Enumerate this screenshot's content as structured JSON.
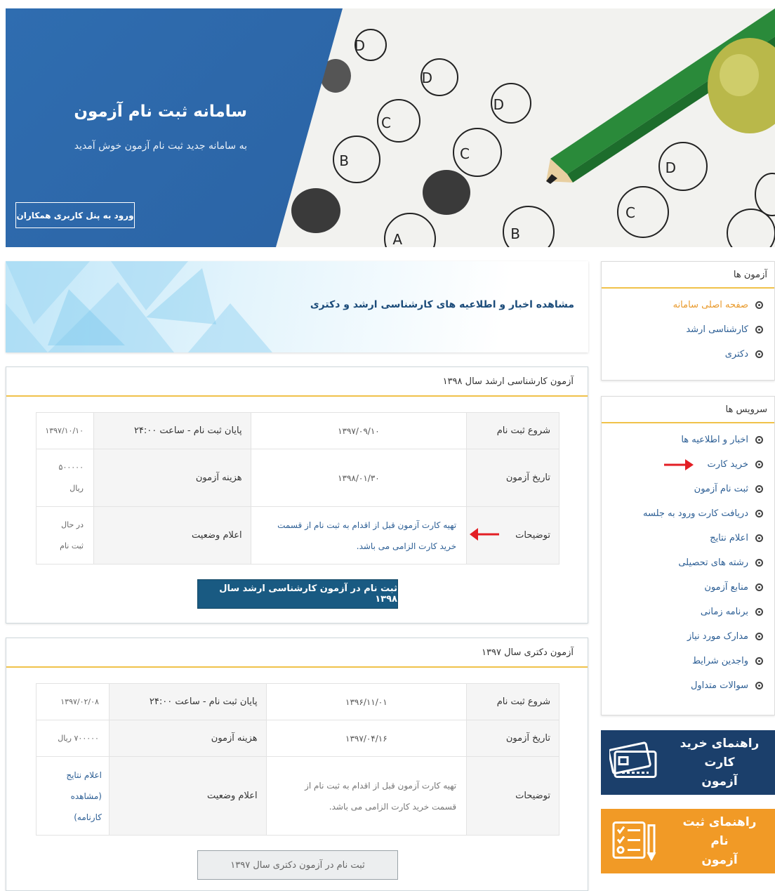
{
  "header": {
    "title": "سامانه ثبت نام آزمون",
    "subtitle": "به سامانه جدید ثبت نام آزمون خوش آمدید",
    "login_button": "ورود به پنل کاربری همکاران",
    "accent_color": "#2f6db0"
  },
  "sidebar": {
    "exams_box": {
      "title": "آزمون ها",
      "items": [
        {
          "label": "صفحه اصلی سامانه",
          "active": true
        },
        {
          "label": "کارشناسی ارشد",
          "active": false
        },
        {
          "label": "دکتری",
          "active": false
        }
      ]
    },
    "services_box": {
      "title": "سرویس ها",
      "items": [
        {
          "label": "اخبار و اطلاعیه ها"
        },
        {
          "label": "خرید کارت"
        },
        {
          "label": "ثبت نام آزمون"
        },
        {
          "label": "دریافت کارت ورود به جلسه"
        },
        {
          "label": "اعلام نتایج"
        },
        {
          "label": "رشته های تحصیلی"
        },
        {
          "label": "منابع آزمون"
        },
        {
          "label": "برنامه زمانی"
        },
        {
          "label": "مدارک مورد نیاز"
        },
        {
          "label": "واجدین شرایط"
        },
        {
          "label": "سوالات متداول"
        }
      ]
    },
    "guide_card": {
      "line1": "راهنمای خرید کارت",
      "line2": "آزمون",
      "color": "#1b3f6b",
      "icon": "credit-card-icon"
    },
    "guide_register": {
      "line1": "راهنمای ثبت نام",
      "line2": "آزمون",
      "color": "#f19a26",
      "icon": "checklist-icon"
    }
  },
  "news_banner": {
    "title": "مشاهده اخبار و اطلاعیه های کارشناسی ارشد و دکتری"
  },
  "exams": [
    {
      "title": "آزمون کارشناسی ارشد سال ۱۳۹۸",
      "rows": {
        "reg_start_label": "شروع ثبت نام",
        "reg_start_value": "۱۳۹۷/۰۹/۱۰",
        "reg_end_label": "پایان ثبت نام - ساعت ۲۴:۰۰",
        "reg_end_value": "۱۳۹۷/۱۰/۱۰",
        "exam_date_label": "تاریخ آزمون",
        "exam_date_value": "۱۳۹۸/۰۱/۳۰",
        "fee_label": "هزینه آزمون",
        "fee_amount": "۵۰۰۰۰۰",
        "fee_unit": "ریال",
        "notes_label": "توضیحات",
        "notes_line1": "تهیه کارت آزمون قبل از اقدام به ثبت نام از قسمت",
        "notes_line2": "خرید کارت الزامی می باشد.",
        "status_label": "اعلام وضعیت",
        "status_line1": "در حال",
        "status_line2": "ثبت نام"
      },
      "button": "ثبت نام در آزمون کارشناسی ارشد سال ۱۳۹۸",
      "button_enabled": true
    },
    {
      "title": "آزمون دکتری سال ۱۳۹۷",
      "rows": {
        "reg_start_label": "شروع ثبت نام",
        "reg_start_value": "۱۳۹۶/۱۱/۰۱",
        "reg_end_label": "پایان ثبت نام - ساعت ۲۴:۰۰",
        "reg_end_value": "۱۳۹۷/۰۲/۰۸",
        "exam_date_label": "تاریخ آزمون",
        "exam_date_value": "۱۳۹۷/۰۴/۱۶",
        "fee_label": "هزینه آزمون",
        "fee_value": "۷۰۰۰۰۰ ریال",
        "notes_label": "توضیحات",
        "notes_line1": "تهیه کارت آزمون قبل از اقدام به ثبت نام از",
        "notes_line2": "قسمت خرید کارت الزامی می باشد.",
        "status_label": "اعلام وضعیت",
        "status_line1": "اعلام نتایج",
        "status_line2": "(مشاهده",
        "status_line3": "کارنامه)"
      },
      "button": "ثبت نام در آزمون دکتری سال ۱۳۹۷",
      "button_enabled": false
    }
  ]
}
